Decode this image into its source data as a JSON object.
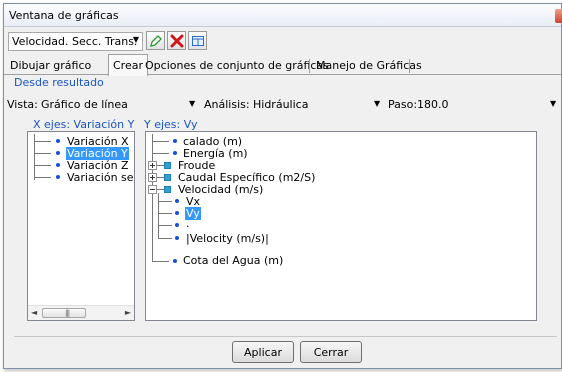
{
  "window": {
    "title": "Ventana de gráficas"
  },
  "toolbar": {
    "combo_value": "Velocidad. Secc. Trans.",
    "icons": [
      "edit-icon",
      "delete-icon",
      "window-icon"
    ]
  },
  "tabs": [
    "Dibujar gráfico",
    "Crear",
    "Opciones de conjunto de gráficas",
    "Manejo de Gráficas"
  ],
  "active_tab": "Crear",
  "group_label": "Desde resultado",
  "vista": {
    "label": "Vista:",
    "value": "Gráfico de línea"
  },
  "analisis": {
    "label": "Análisis:",
    "value": "Hidráulica"
  },
  "paso": {
    "label": "Paso:",
    "value": "180.0"
  },
  "x_axis": {
    "title": "X ejes: Variación Y",
    "items": [
      "Variación X",
      "Variación Y",
      "Variación Z",
      "Variación segu"
    ],
    "selected": "Variación Y"
  },
  "y_axis": {
    "title": "Y ejes: Vy",
    "items": {
      "calado": "calado (m)",
      "energia": "Energía (m)",
      "froude": "Froude",
      "caudal": "Caudal Específico (m2/S)",
      "velocidad": "Velocidad (m/s)",
      "vx": "Vx",
      "vy": "Vy",
      "dot": ".",
      "velocity_abs": "|Velocity (m/s)|",
      "cota": "Cota del Agua (m)"
    },
    "selected": "Vy"
  },
  "buttons": {
    "apply": "Aplicar",
    "close": "Cerrar"
  },
  "colors": {
    "accent": "#1a55c4",
    "selection": "#3399ff"
  }
}
